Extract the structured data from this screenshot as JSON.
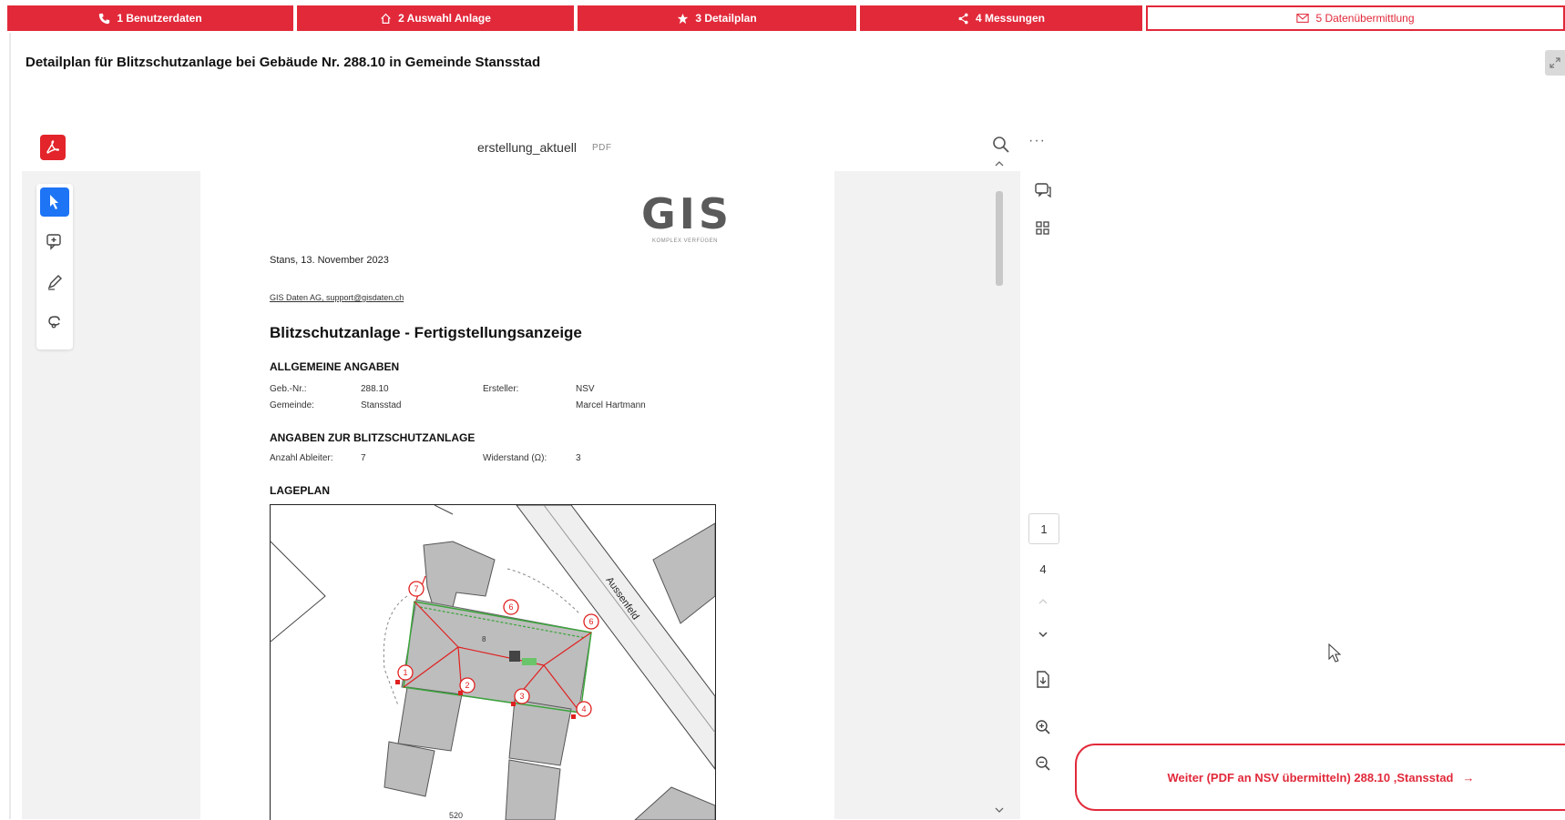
{
  "tabs": [
    {
      "icon": "phone-icon",
      "label": "1 Benutzerdaten"
    },
    {
      "icon": "home-icon",
      "label": "2 Auswahl Anlage"
    },
    {
      "icon": "star-icon",
      "label": "3 Detailplan"
    },
    {
      "icon": "share-icon",
      "label": "4 Messungen"
    },
    {
      "icon": "mail-icon",
      "label": "5 Datenübermittlung"
    }
  ],
  "page_title": "Detailplan für Blitzschutzanlage bei Gebäude Nr. 288.10 in Gemeinde Stansstad",
  "viewer": {
    "doc_name": "erstellung_aktuell",
    "doc_ext": "PDF",
    "current_page": "1",
    "total_pages": "4",
    "icons": [
      "pdf-icon",
      "search-icon",
      "more-icon",
      "select-tool-icon",
      "comment-tool-icon",
      "pen-tool-icon",
      "lasso-tool-icon",
      "comments-panel-icon",
      "thumbnails-icon",
      "page-up-icon",
      "page-down-icon",
      "export-icon",
      "zoom-in-icon",
      "zoom-out-icon"
    ]
  },
  "pdf": {
    "logo_text": "GIS",
    "logo_sub": "KOMPLEX VERFÜGEN",
    "date_line": "Stans, 13. November 2023",
    "contact": "GIS Daten AG, support@gisdaten.ch",
    "heading": "Blitzschutzanlage - Fertigstellungsanzeige",
    "section1": "ALLGEMEINE ANGABEN",
    "geb_label": "Geb.-Nr.:",
    "geb_value": "288.10",
    "gem_label": "Gemeinde:",
    "gem_value": "Stansstad",
    "ersteller_label": "Ersteller:",
    "ersteller_value1": "NSV",
    "ersteller_value2": "Marcel Hartmann",
    "section2": "ANGABEN ZUR BLITZSCHUTZANLAGE",
    "ableiter_label": "Anzahl Ableiter:",
    "ableiter_value": "7",
    "widerstand_label": "Widerstand (Ω):",
    "widerstand_value": "3",
    "section3": "LAGEPLAN",
    "street_label": "Aussenfeld",
    "map_markers": [
      "1",
      "2",
      "3",
      "4",
      "5",
      "6",
      "7"
    ],
    "map_number": "8",
    "map_bottom": "520"
  },
  "cta": {
    "label": "Weiter (PDF an NSV übermitteln) 288.10 ,Stansstad",
    "arrow": "→"
  },
  "colors": {
    "brand_red": "#e1293a",
    "select_blue": "#1d74f5"
  }
}
